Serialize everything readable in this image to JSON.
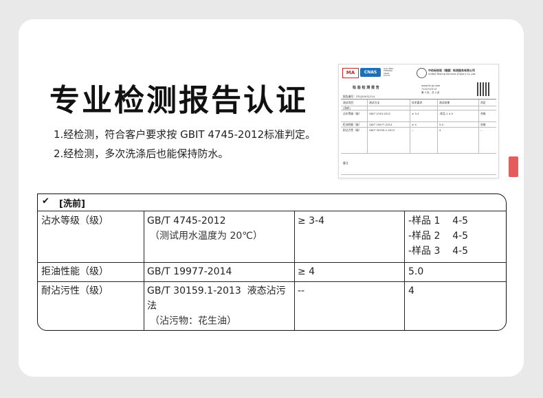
{
  "page": {
    "title": "专业检测报告认证",
    "bullets": [
      "1.经检测，符合客户要求按 GBIT 4745-2012标准判定。",
      "2.经检测，多次洗涤后也能保持防水。"
    ]
  },
  "report": {
    "logo_ma": "MA",
    "logo_cnas": "CNAS",
    "logo_ilac": "ILAC MRA TESTING CNAS L5773",
    "org_name": "中纺标检验（福建）检测服务有限公司",
    "org_name_en": "United Testing Services (Fujian) Co.,Ltd.",
    "title": "检 验 检 测 报 告",
    "report_no": "报告编号：ZFLJ20031214",
    "site": "www.fzl-qz.com",
    "phone": "7110710113",
    "page_info": "第 3 页，共 4 页",
    "header_cells": [
      "测试项目",
      "测试方法",
      "技术要求",
      "测试结果",
      "判定"
    ],
    "section": "[洗前]",
    "rows": [
      [
        "沾水等级（级）",
        "GB/T 4745-2012",
        "≥ 3-4",
        "-样品 1 4-5",
        "合格"
      ],
      [
        "拒油性能（级）",
        "GB/T 19977-2014",
        "≥ 4",
        "5.0",
        "合格"
      ],
      [
        "耐沾污性（级）",
        "GB/T 30159.1-2013",
        "--",
        "4",
        "--"
      ]
    ],
    "remark_label": "备注"
  },
  "table": {
    "section_label": "[洗前]",
    "rows": [
      {
        "item": "沾水等级（级）",
        "method": "GB/T 4745-2012",
        "method_note": "（测试用水温度为 20℃）",
        "requirement": "≥ 3-4",
        "results": [
          "-样品 1    4-5",
          "-样品 2    4-5",
          "-样品 3    4-5"
        ]
      },
      {
        "item": "拒油性能（级）",
        "method": "GB/T 19977-2014",
        "requirement": "≥ 4",
        "results": [
          "5.0"
        ]
      },
      {
        "item": "耐沾污性（级）",
        "method": "GB/T 30159.1-2013  液态沾污",
        "method_line2": "法",
        "method_note": "（沾污物：花生油）",
        "requirement": "--",
        "results": [
          "4"
        ]
      }
    ]
  }
}
